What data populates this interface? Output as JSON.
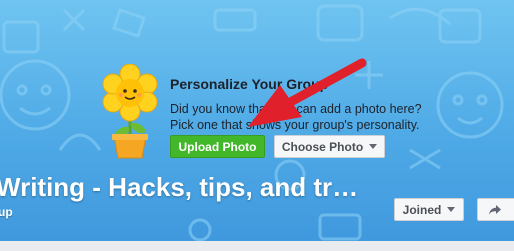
{
  "prompt": {
    "heading": "Personalize Your Group",
    "line1": "Did you know that you can add a photo here?",
    "line2": "Pick one that shows your group's personality.",
    "upload_label": "Upload Photo",
    "choose_label": "Choose Photo"
  },
  "group": {
    "title": "Writing - Hacks, tips, and tr…",
    "subtitle": "up",
    "joined_label": "Joined"
  },
  "colors": {
    "background": "#4ea9e6",
    "upload_button": "#42b72a",
    "arrow": "#e0202a"
  },
  "icons": [
    "flower-icon",
    "caret-down-icon",
    "share-arrow-icon",
    "annotation-arrow-icon"
  ]
}
